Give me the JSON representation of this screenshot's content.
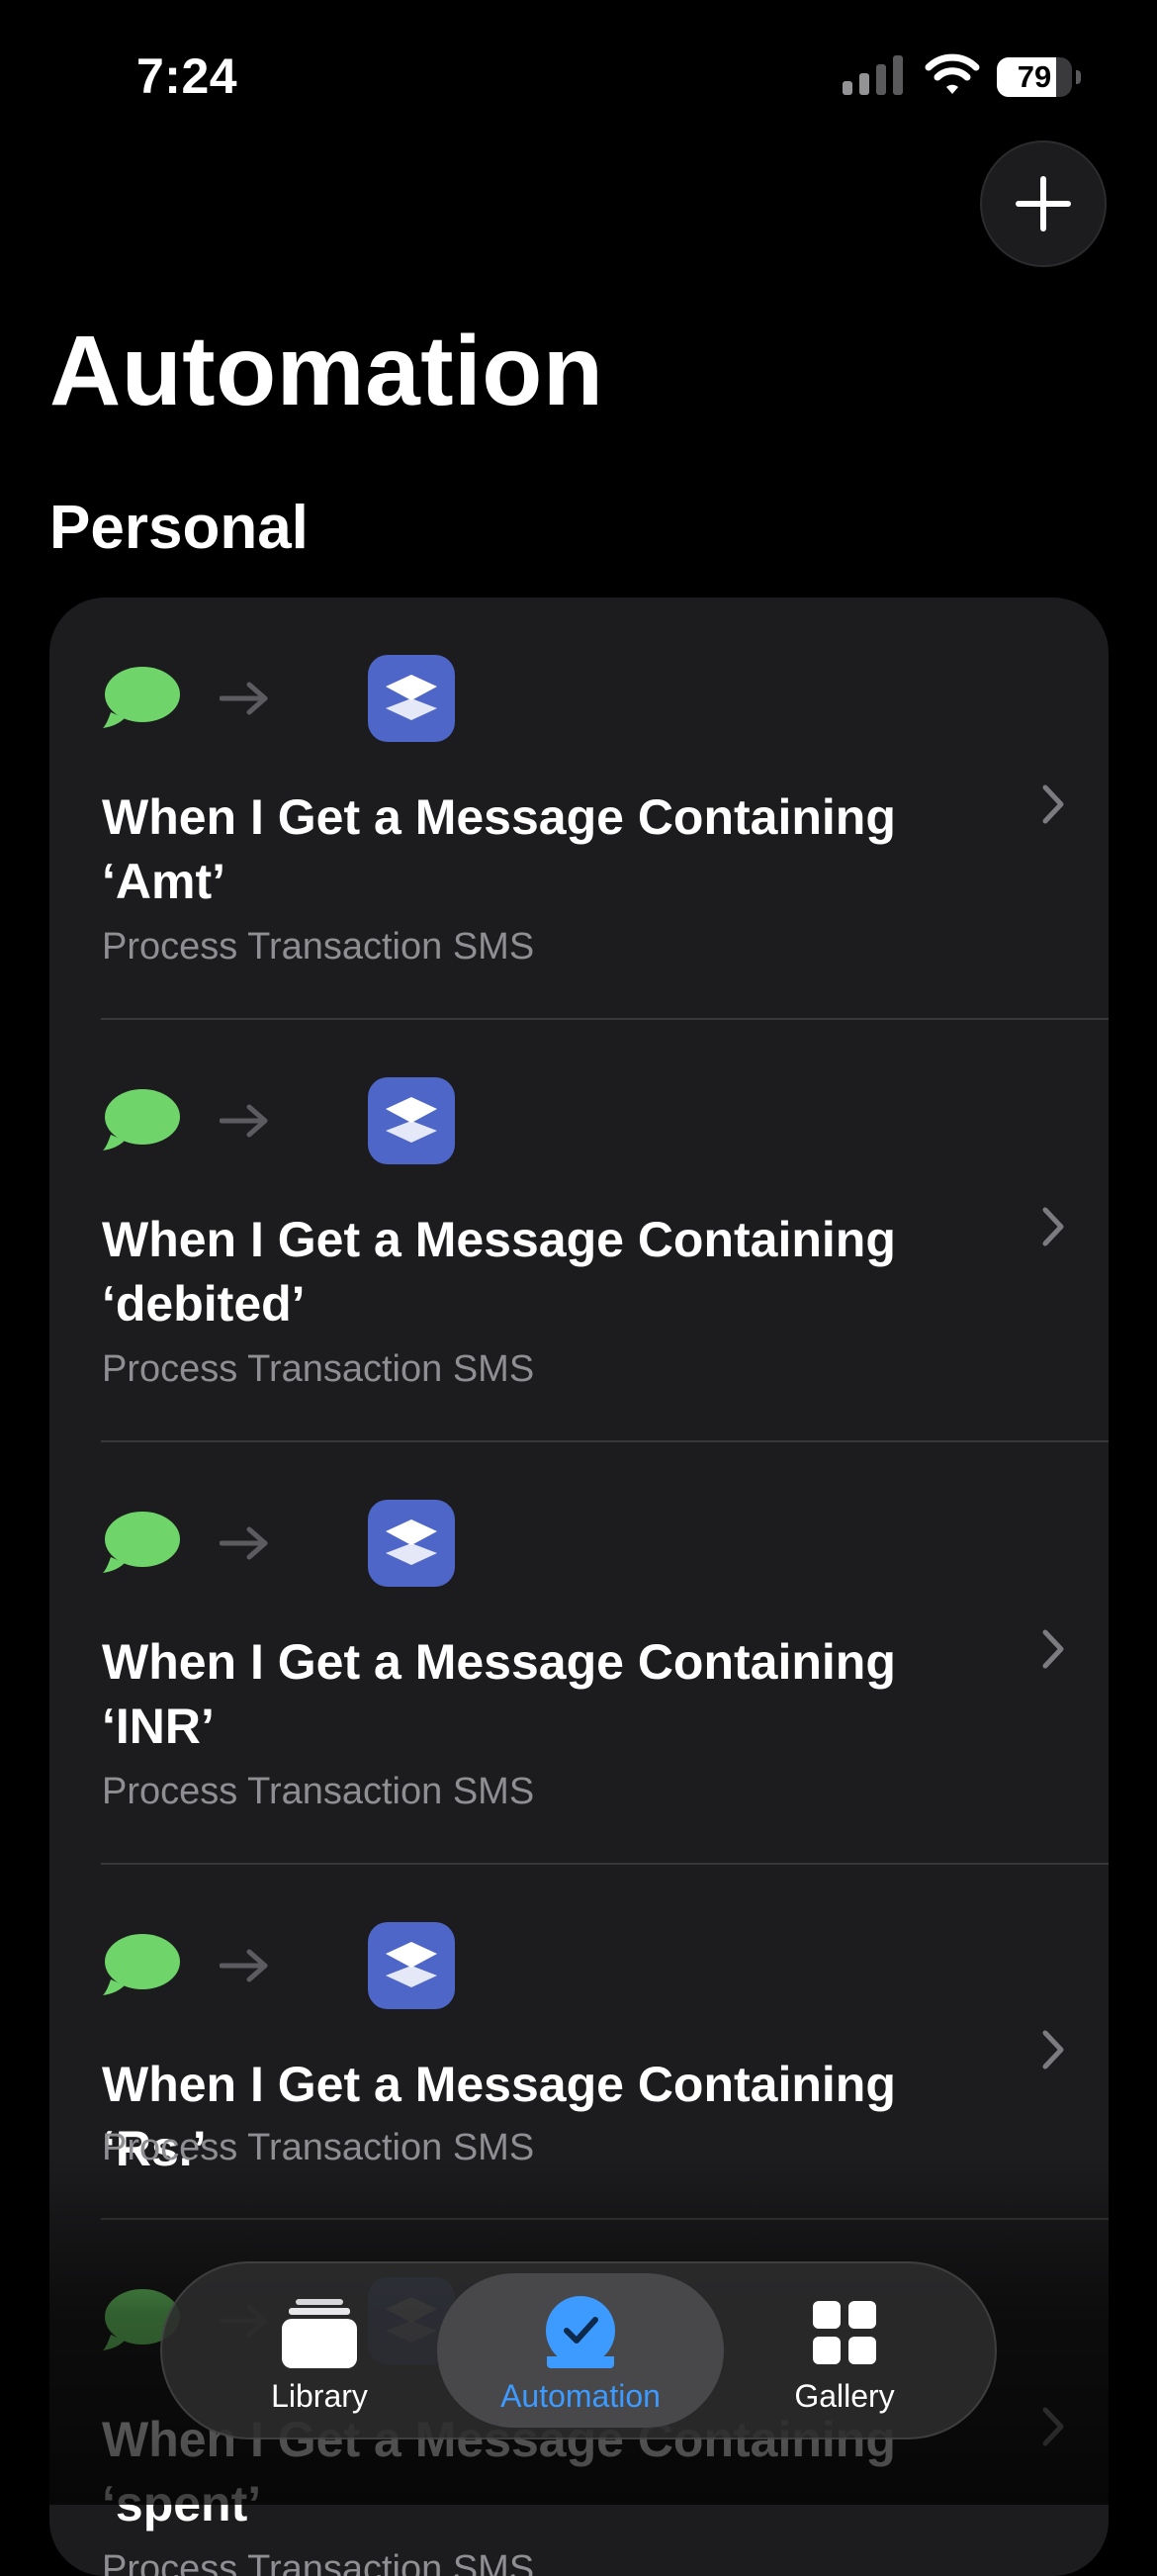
{
  "status_bar": {
    "time": "7:24",
    "battery_level": 79,
    "battery_text": "79",
    "icons": [
      "cellular-signal-icon",
      "wifi-icon",
      "battery-icon"
    ]
  },
  "header": {
    "title": "Automation",
    "add_button_icon": "plus-icon"
  },
  "section": {
    "title": "Personal"
  },
  "automations": [
    {
      "title": "When I Get a Message Containing ‘Amt’",
      "subtitle": "Process Transaction SMS",
      "trigger_icon": "message-bubble-icon",
      "action_icon": "shortcuts-icon"
    },
    {
      "title": "When I Get a Message Containing ‘debited’",
      "subtitle": "Process Transaction SMS",
      "trigger_icon": "message-bubble-icon",
      "action_icon": "shortcuts-icon"
    },
    {
      "title": "When I Get a Message Containing ‘INR’",
      "subtitle": "Process Transaction SMS",
      "trigger_icon": "message-bubble-icon",
      "action_icon": "shortcuts-icon"
    },
    {
      "title": "When I Get a Message Containing ‘Rs.’",
      "subtitle": "Process Transaction SMS",
      "trigger_icon": "message-bubble-icon",
      "action_icon": "shortcuts-icon"
    },
    {
      "title": "When I Get a Message Containing ‘spent’",
      "subtitle": "Process Transaction SMS",
      "trigger_icon": "message-bubble-icon",
      "action_icon": "shortcuts-icon"
    }
  ],
  "tab_bar": {
    "tabs": [
      {
        "label": "Library",
        "icon": "library-stack-icon",
        "selected": false
      },
      {
        "label": "Automation",
        "icon": "automation-clock-check-icon",
        "selected": true
      },
      {
        "label": "Gallery",
        "icon": "gallery-grid-icon",
        "selected": false
      }
    ]
  },
  "colors": {
    "background": "#000000",
    "card": "#1c1c1e",
    "message_green": "#6fd46a",
    "shortcut_blue": "#4e66c8",
    "accent": "#3d9bff",
    "secondary_text": "#8e8e93"
  }
}
